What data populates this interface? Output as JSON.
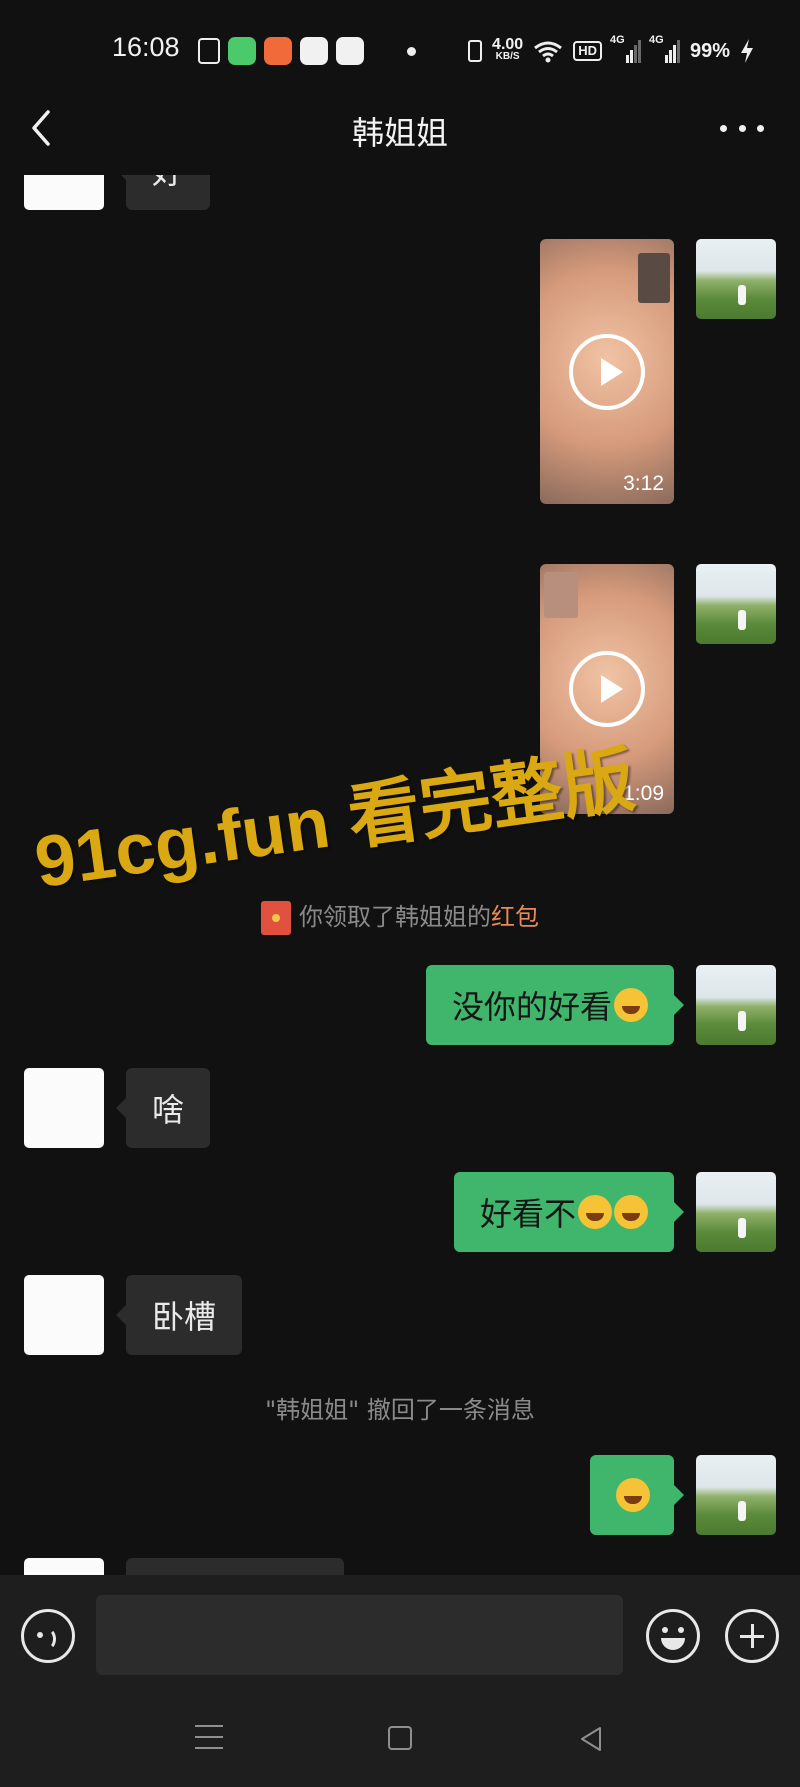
{
  "status_bar": {
    "time": "16:08",
    "net_speed_value": "4.00",
    "net_speed_unit": "KB/S",
    "hd_label": "HD",
    "sim1_label": "4G",
    "sim2_label": "4G",
    "battery": "99%"
  },
  "header": {
    "title": "韩姐姐"
  },
  "messages": {
    "m1_text": "好",
    "m1_duration": "3:12",
    "m2_duration": "1:09",
    "redpacket_prefix": "你领取了韩姐姐的",
    "redpacket_link": "红包",
    "m3_text": "没你的好看",
    "m4_text": "啥",
    "m5_text": "好看不",
    "m6_text": "卧槽",
    "recall_notice": "\"韩姐姐\" 撤回了一条消息"
  },
  "watermark": "91cg.fun 看完整版",
  "colors": {
    "background": "#111111",
    "outgoing_bubble": "#3fb66b",
    "incoming_bubble": "#2c2c2c",
    "watermark": "#d9a812",
    "redpacket_link": "#e88a5a"
  },
  "icons": {
    "back": "chevron-left-icon",
    "more": "more-dots-icon",
    "voice": "voice-icon",
    "emoji": "emoji-icon",
    "plus": "plus-icon"
  }
}
